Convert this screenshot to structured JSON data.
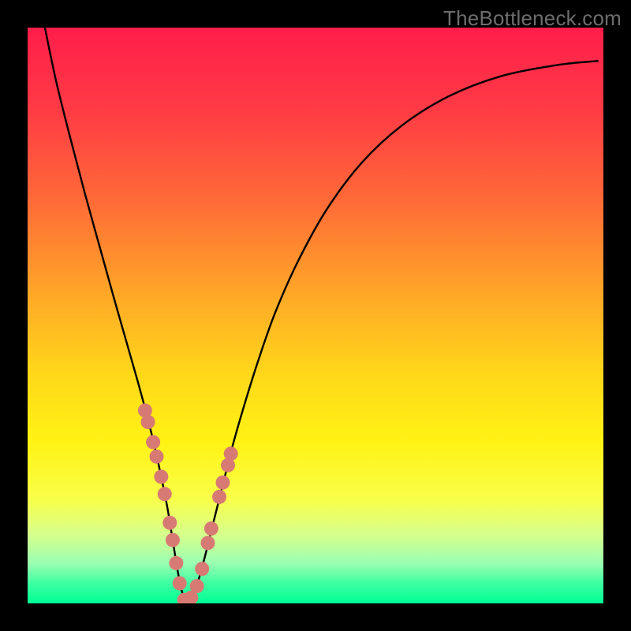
{
  "watermark": "TheBottleneck.com",
  "chart_data": {
    "type": "line",
    "title": "",
    "xlabel": "",
    "ylabel": "",
    "xlim": [
      0,
      100
    ],
    "ylim": [
      0,
      100
    ],
    "gradient_stops": [
      {
        "pos": 0.0,
        "color": "#ff1e4a"
      },
      {
        "pos": 0.14,
        "color": "#ff3a45"
      },
      {
        "pos": 0.3,
        "color": "#ff6a38"
      },
      {
        "pos": 0.46,
        "color": "#ffa627"
      },
      {
        "pos": 0.6,
        "color": "#ffd71a"
      },
      {
        "pos": 0.72,
        "color": "#fff314"
      },
      {
        "pos": 0.82,
        "color": "#f8ff4a"
      },
      {
        "pos": 0.88,
        "color": "#d7ff8c"
      },
      {
        "pos": 0.93,
        "color": "#9bffb1"
      },
      {
        "pos": 0.965,
        "color": "#3effa2"
      },
      {
        "pos": 1.0,
        "color": "#00ff95"
      }
    ],
    "series": [
      {
        "name": "bottleneck-curve",
        "x": [
          3.0,
          5.0,
          7.5,
          10.0,
          12.5,
          15.0,
          17.0,
          19.0,
          20.5,
          22.0,
          23.2,
          24.3,
          25.2,
          26.0,
          26.7,
          27.3,
          28.0,
          29.0,
          30.5,
          32.5,
          34.0,
          35.5,
          37.5,
          40.0,
          43.0,
          47.0,
          52.0,
          58.0,
          65.0,
          73.0,
          82.0,
          92.0,
          99.0
        ],
        "y": [
          100,
          90.5,
          80.5,
          71.0,
          62.0,
          53.0,
          46.0,
          39.0,
          33.5,
          27.5,
          22.0,
          16.5,
          11.0,
          6.0,
          2.5,
          0.5,
          0.5,
          2.0,
          7.0,
          15.0,
          21.0,
          27.0,
          34.0,
          42.0,
          50.5,
          59.5,
          68.5,
          76.5,
          83.0,
          88.0,
          91.5,
          93.5,
          94.2
        ]
      }
    ],
    "markers": {
      "name": "highlight-points",
      "color": "#d87a74",
      "x": [
        20.4,
        20.9,
        21.8,
        22.4,
        23.2,
        23.8,
        24.7,
        25.2,
        25.8,
        26.4,
        27.2,
        27.9,
        28.4,
        29.4,
        30.3,
        31.3,
        31.9,
        33.3,
        33.9,
        34.8,
        35.3
      ],
      "y": [
        33.5,
        31.5,
        28.0,
        25.5,
        22.0,
        19.0,
        14.0,
        11.0,
        7.0,
        3.5,
        0.6,
        0.6,
        1.0,
        3.0,
        6.0,
        10.5,
        13.0,
        18.5,
        21.0,
        24.0,
        26.0
      ]
    }
  }
}
